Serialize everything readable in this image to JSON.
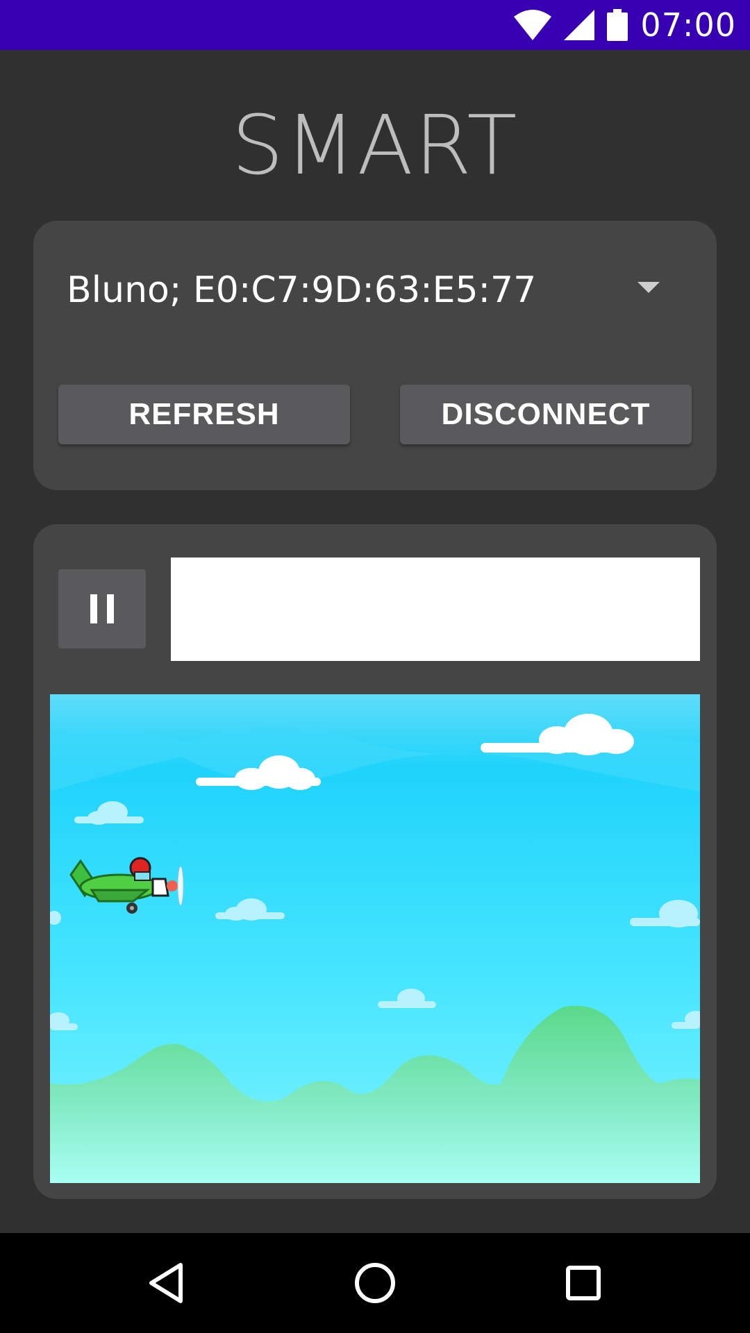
{
  "status_bar": {
    "time": "07:00",
    "background_color": "#3700b3"
  },
  "app": {
    "title": "SMART"
  },
  "connection": {
    "selected_device": "Bluno; E0:C7:9D:63:E5:77",
    "refresh_label": "REFRESH",
    "disconnect_label": "DISCONNECT"
  },
  "game": {
    "pause_icon": "pause-icon",
    "text_field_value": "",
    "scene": "airplane-sky"
  },
  "nav_bar": {
    "icons": [
      "back-icon",
      "home-icon",
      "recent-apps-icon"
    ]
  }
}
